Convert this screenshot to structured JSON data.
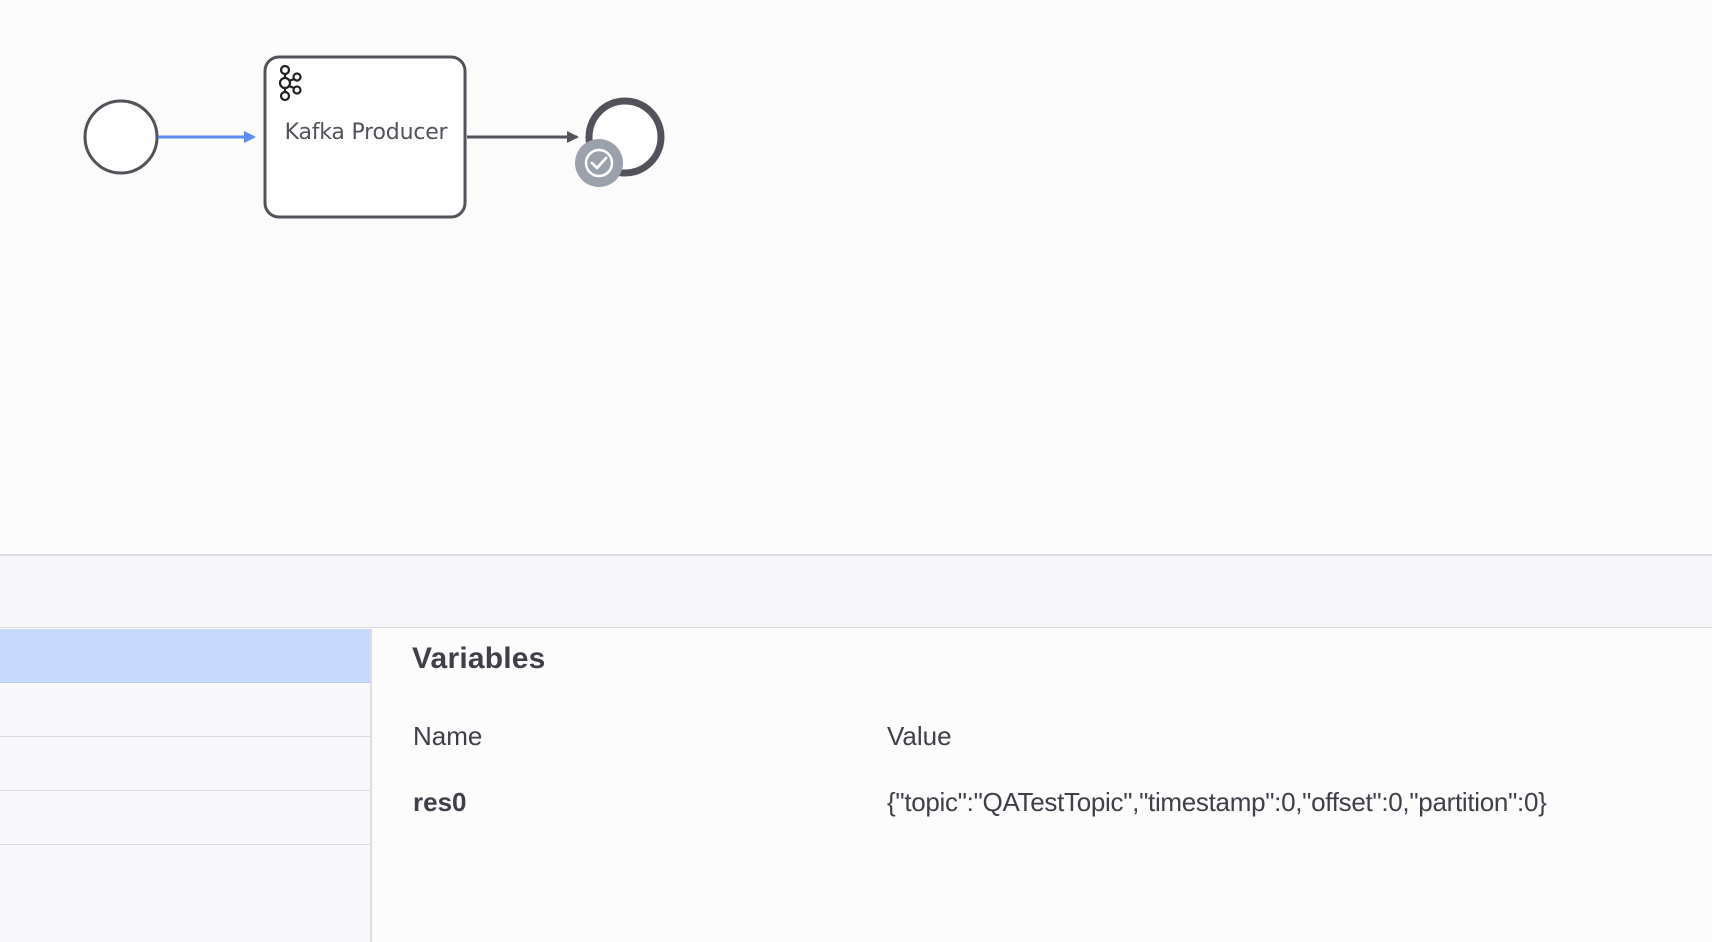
{
  "diagram": {
    "task": {
      "label": "Kafka Producer",
      "icon": "kafka-icon"
    },
    "start_event_icon": "start-event-circle",
    "end_event_icon": "end-event-circle",
    "completed_badge_icon": "check-circle-icon",
    "colors": {
      "active_flow": "#5b8def",
      "stroke": "#52535a",
      "badge": "#9aa1ad"
    }
  },
  "variables_panel": {
    "title": "Variables",
    "columns": {
      "name": "Name",
      "value": "Value"
    },
    "rows": [
      {
        "name": "res0",
        "value": "{\"topic\":\"QATestTopic\",\"timestamp\":0,\"offset\":0,\"partition\":0}"
      }
    ]
  },
  "tree_rows": [
    {
      "selected": true
    },
    {
      "selected": false
    },
    {
      "selected": false
    },
    {
      "selected": false
    }
  ],
  "colors": {
    "selected_row": "#c5d9fb",
    "panel_header": "#f6f6f8"
  }
}
